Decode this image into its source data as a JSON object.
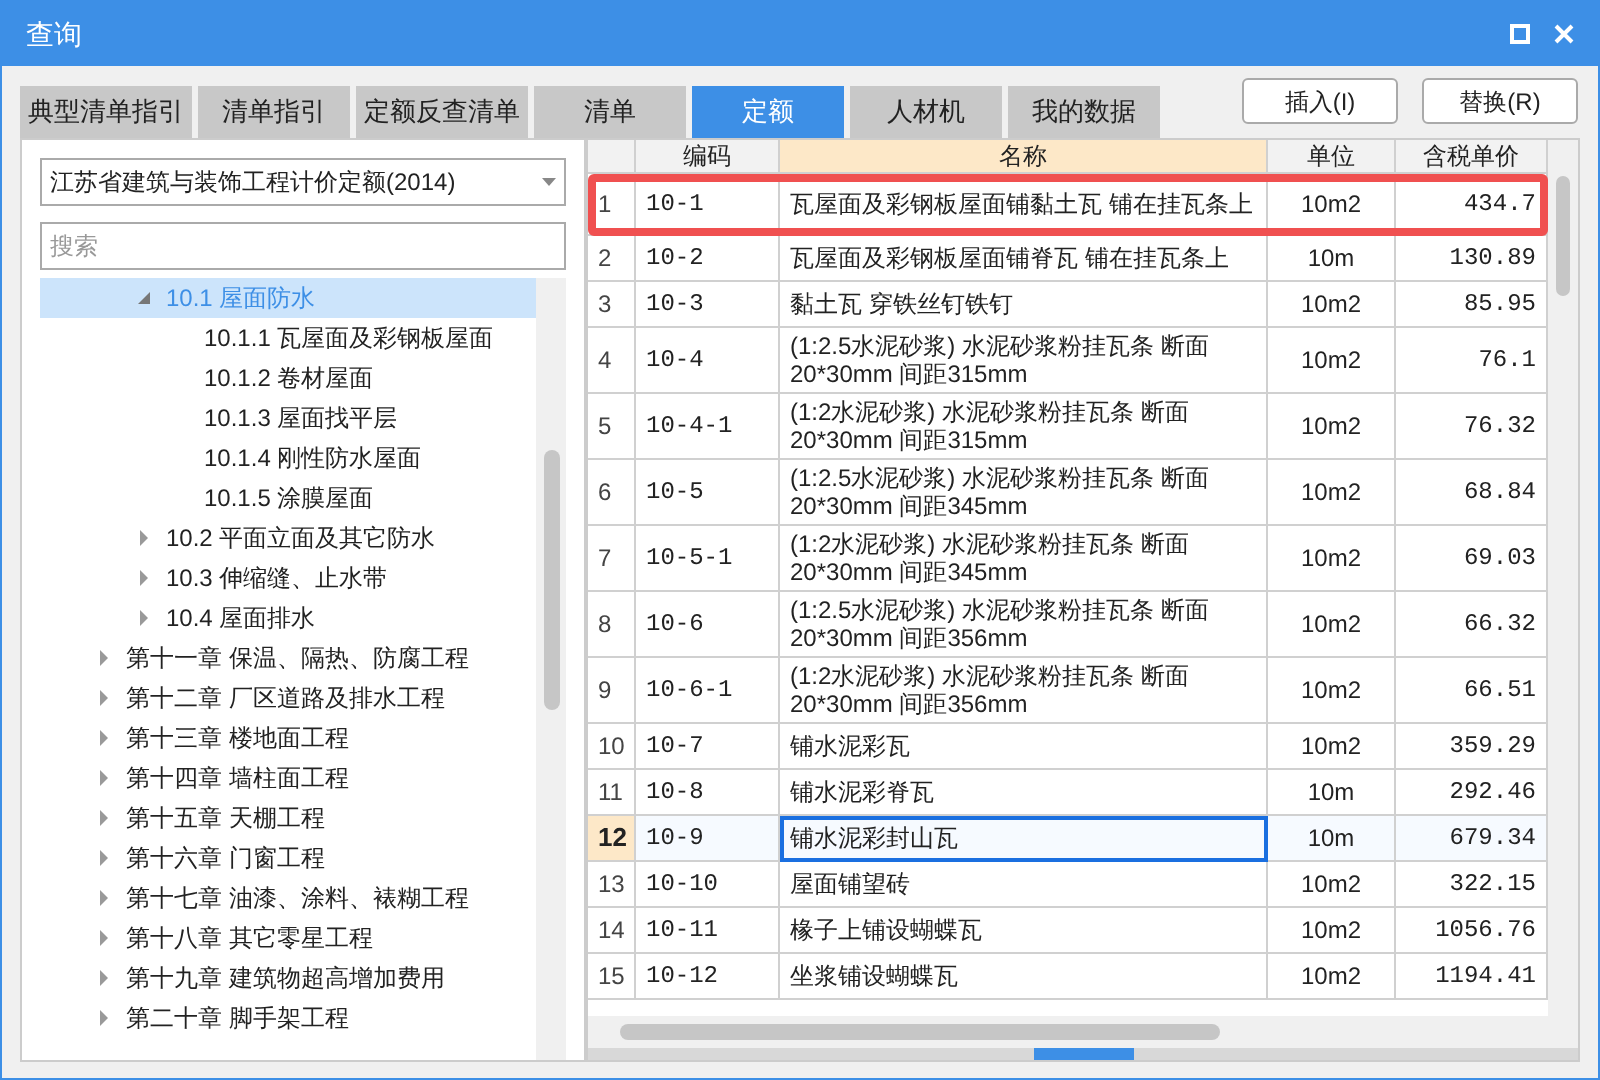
{
  "window": {
    "title": "查询"
  },
  "tabs": [
    {
      "label": "典型清单指引",
      "selected": false
    },
    {
      "label": "清单指引",
      "selected": false
    },
    {
      "label": "定额反查清单",
      "selected": false
    },
    {
      "label": "清单",
      "selected": false
    },
    {
      "label": "定额",
      "selected": true
    },
    {
      "label": "人材机",
      "selected": false
    },
    {
      "label": "我的数据",
      "selected": false
    }
  ],
  "buttons": [
    "插入(I)",
    "替换(R)"
  ],
  "quota_select": {
    "value": "江苏省建筑与装饰工程计价定额(2014)"
  },
  "search": {
    "placeholder": "搜索"
  },
  "tree": {
    "section_items": [
      {
        "label": "10.1 屋面防水",
        "expanded": true,
        "selected": true,
        "children": [
          {
            "label": "10.1.1 瓦屋面及彩钢板屋面",
            "selected": false
          },
          {
            "label": "10.1.2 卷材屋面",
            "selected": false
          },
          {
            "label": "10.1.3 屋面找平层",
            "selected": false
          },
          {
            "label": "10.1.4 刚性防水屋面",
            "selected": false
          },
          {
            "label": "10.1.5 涂膜屋面",
            "selected": false
          }
        ]
      },
      {
        "label": "10.2 平面立面及其它防水",
        "expanded": false,
        "selected": false
      },
      {
        "label": "10.3 伸缩缝、止水带",
        "expanded": false,
        "selected": false
      },
      {
        "label": "10.4 屋面排水",
        "expanded": false,
        "selected": false
      }
    ],
    "chapters": [
      {
        "label": "第十一章 保温、隔热、防腐工程",
        "expanded": false,
        "selected": false
      },
      {
        "label": "第十二章 厂区道路及排水工程",
        "expanded": false,
        "selected": false
      },
      {
        "label": "第十三章 楼地面工程",
        "expanded": false,
        "selected": false
      },
      {
        "label": "第十四章 墙柱面工程",
        "expanded": false,
        "selected": false
      },
      {
        "label": "第十五章 天棚工程",
        "expanded": false,
        "selected": false
      },
      {
        "label": "第十六章 门窗工程",
        "expanded": false,
        "selected": false
      },
      {
        "label": "第十七章 油漆、涂料、裱糊工程",
        "expanded": false,
        "selected": false
      },
      {
        "label": "第十八章 其它零星工程",
        "expanded": false,
        "selected": false
      },
      {
        "label": "第十九章 建筑物超高增加费用",
        "expanded": false,
        "selected": false
      },
      {
        "label": "第二十章 脚手架工程",
        "expanded": false,
        "selected": false
      }
    ]
  },
  "table": {
    "columns": [
      {
        "label": "编码",
        "selected": false
      },
      {
        "label": "名称",
        "selected": true
      },
      {
        "label": "单位",
        "selected": false
      },
      {
        "label": "含税单价",
        "selected": false
      }
    ],
    "rows": [
      {
        "num": "1",
        "code": "10-1",
        "name": "瓦屋面及彩钢板屋面铺黏土瓦 铺在挂瓦条上",
        "unit": "10m2",
        "price": "434.7",
        "selected": false,
        "highlighted": true
      },
      {
        "num": "2",
        "code": "10-2",
        "name": "瓦屋面及彩钢板屋面铺脊瓦 铺在挂瓦条上",
        "unit": "10m",
        "price": "130.89",
        "selected": false,
        "highlighted": false
      },
      {
        "num": "3",
        "code": "10-3",
        "name": "黏土瓦 穿铁丝钉铁钉",
        "unit": "10m2",
        "price": "85.95",
        "selected": false,
        "highlighted": false
      },
      {
        "num": "4",
        "code": "10-4",
        "name": "(1:2.5水泥砂浆) 水泥砂浆粉挂瓦条 断面\n20*30mm 间距315mm",
        "unit": "10m2",
        "price": "76.1",
        "selected": false,
        "highlighted": false
      },
      {
        "num": "5",
        "code": "10-4-1",
        "name": "(1:2水泥砂浆) 水泥砂浆粉挂瓦条 断面\n20*30mm 间距315mm",
        "unit": "10m2",
        "price": "76.32",
        "selected": false,
        "highlighted": false
      },
      {
        "num": "6",
        "code": "10-5",
        "name": "(1:2.5水泥砂浆) 水泥砂浆粉挂瓦条 断面\n20*30mm 间距345mm",
        "unit": "10m2",
        "price": "68.84",
        "selected": false,
        "highlighted": false
      },
      {
        "num": "7",
        "code": "10-5-1",
        "name": "(1:2水泥砂浆) 水泥砂浆粉挂瓦条 断面\n20*30mm 间距345mm",
        "unit": "10m2",
        "price": "69.03",
        "selected": false,
        "highlighted": false
      },
      {
        "num": "8",
        "code": "10-6",
        "name": "(1:2.5水泥砂浆) 水泥砂浆粉挂瓦条 断面\n20*30mm 间距356mm",
        "unit": "10m2",
        "price": "66.32",
        "selected": false,
        "highlighted": false
      },
      {
        "num": "9",
        "code": "10-6-1",
        "name": "(1:2水泥砂浆) 水泥砂浆粉挂瓦条 断面\n20*30mm 间距356mm",
        "unit": "10m2",
        "price": "66.51",
        "selected": false,
        "highlighted": false
      },
      {
        "num": "10",
        "code": "10-7",
        "name": "铺水泥彩瓦",
        "unit": "10m2",
        "price": "359.29",
        "selected": false,
        "highlighted": false
      },
      {
        "num": "11",
        "code": "10-8",
        "name": "铺水泥彩脊瓦",
        "unit": "10m",
        "price": "292.46",
        "selected": false,
        "highlighted": false
      },
      {
        "num": "12",
        "code": "10-9",
        "name": "铺水泥彩封山瓦",
        "unit": "10m",
        "price": "679.34",
        "selected": true,
        "highlighted": false
      },
      {
        "num": "13",
        "code": "10-10",
        "name": "屋面铺望砖",
        "unit": "10m2",
        "price": "322.15",
        "selected": false,
        "highlighted": false
      },
      {
        "num": "14",
        "code": "10-11",
        "name": "椽子上铺设蝴蝶瓦",
        "unit": "10m2",
        "price": "1056.76",
        "selected": false,
        "highlighted": false
      },
      {
        "num": "15",
        "code": "10-12",
        "name": "坐浆铺设蝴蝶瓦",
        "unit": "10m2",
        "price": "1194.41",
        "selected": false,
        "highlighted": false
      }
    ]
  }
}
